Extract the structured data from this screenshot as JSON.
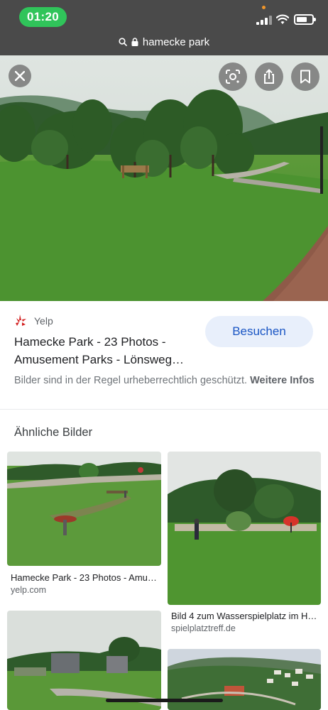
{
  "status_bar": {
    "time": "01:20",
    "icons": [
      "signal-icon",
      "wifi-icon",
      "battery-icon"
    ],
    "time_pill_color": "#30c45a"
  },
  "url_bar": {
    "icon_search": "search-icon",
    "icon_lock": "lock-icon",
    "text": "hamecke park"
  },
  "hero": {
    "buttons": [
      "close-icon",
      "lens-icon",
      "share-icon",
      "bookmark-icon"
    ]
  },
  "result": {
    "source_name": "Yelp",
    "source_icon": "yelp-logo-icon",
    "title": "Hamecke Park - 23 Photos - Amusement Parks - Lönsweg…",
    "visit_label": "Besuchen",
    "copyright_text": "Bilder sind in der Regel urheberrechtlich geschützt.",
    "more_info_label": "Weitere Infos"
  },
  "similar": {
    "heading": "Ähnliche Bilder",
    "items": [
      {
        "title": "Hamecke Park - 23 Photos - Amu…",
        "domain": "yelp.com"
      },
      {
        "title": "Bild 4 zum Wasserspielplatz im H…",
        "domain": "spielplatztreff.de"
      },
      {
        "title": "",
        "domain": ""
      },
      {
        "title": "",
        "domain": ""
      }
    ]
  },
  "colors": {
    "accent_blue": "#1a56c4",
    "button_bg": "#e8effb",
    "yelp_red": "#d32323",
    "topbar": "#4a4a4a"
  }
}
